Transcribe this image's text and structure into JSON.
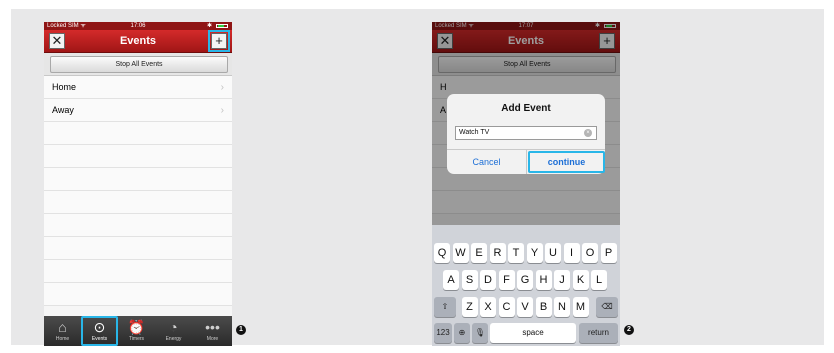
{
  "screen1": {
    "status": {
      "carrier": "Locked SIM ᯤ",
      "time": "17:06",
      "bt": "✱"
    },
    "nav": {
      "title": "Events",
      "left_icon": "tools-icon",
      "right_icon": "plus-icon"
    },
    "stop_all_label": "Stop All Events",
    "events": [
      {
        "label": "Home"
      },
      {
        "label": "Away"
      }
    ],
    "tabs": [
      {
        "label": "Home",
        "icon": "home-icon"
      },
      {
        "label": "Events",
        "icon": "play-icon"
      },
      {
        "label": "Timers",
        "icon": "alarm-clock-icon"
      },
      {
        "label": "Energy",
        "icon": "gauge-icon"
      },
      {
        "label": "More",
        "icon": "more-icon"
      }
    ],
    "marker": "1"
  },
  "screen2": {
    "status": {
      "carrier": "Locked SIM ᯤ",
      "time": "17:07",
      "bt": "✱"
    },
    "nav": {
      "title": "Events"
    },
    "stop_all_label": "Stop All Events",
    "list_initials": [
      "H",
      "A"
    ],
    "dialog": {
      "title": "Add Event",
      "input_value": "Watch TV",
      "cancel_label": "Cancel",
      "continue_label": "continue"
    },
    "keyboard": {
      "row1": [
        "Q",
        "W",
        "E",
        "R",
        "T",
        "Y",
        "U",
        "I",
        "O",
        "P"
      ],
      "row2": [
        "A",
        "S",
        "D",
        "F",
        "G",
        "H",
        "J",
        "K",
        "L"
      ],
      "row3": [
        "Z",
        "X",
        "C",
        "V",
        "B",
        "N",
        "M"
      ],
      "numbers_label": "123",
      "space_label": "space",
      "return_label": "return"
    },
    "marker": "2"
  },
  "colors": {
    "accent": "#29b6e8",
    "navbar": "#c21f1f",
    "link": "#1d6fd6"
  }
}
